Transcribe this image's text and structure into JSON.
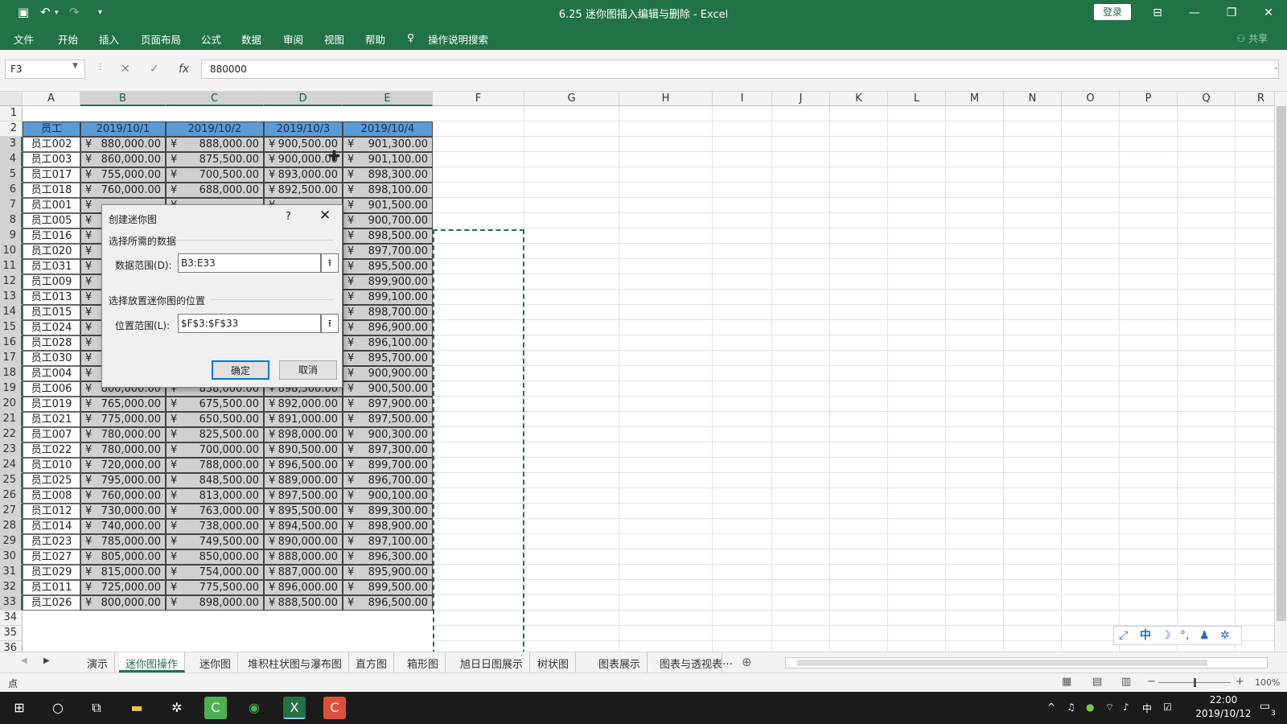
{
  "app": {
    "doc_title": "6.25 迷你图插入编辑与删除  -  Excel",
    "login": "登录",
    "share": "共享",
    "brand_color": "#217346"
  },
  "ribbon_tabs": [
    "文件",
    "开始",
    "插入",
    "页面布局",
    "公式",
    "数据",
    "审阅",
    "视图",
    "帮助",
    "操作说明搜索"
  ],
  "formula": {
    "name_box": "F3",
    "value": "880000"
  },
  "columns": [
    "A",
    "B",
    "C",
    "D",
    "E",
    "F",
    "G",
    "H",
    "I",
    "J",
    "K",
    "L",
    "M",
    "N",
    "O",
    "P",
    "Q",
    "R"
  ],
  "row_numbers": [
    "1",
    "2",
    "3",
    "4",
    "5",
    "6",
    "7",
    "8",
    "9",
    "10",
    "11",
    "12",
    "13",
    "14",
    "15",
    "16",
    "17",
    "18",
    "19",
    "20",
    "21",
    "22",
    "23",
    "24",
    "25",
    "26",
    "27",
    "28",
    "29",
    "30",
    "31",
    "32",
    "33",
    "34",
    "35",
    "36"
  ],
  "table": {
    "headers": [
      "员工",
      "2019/10/1",
      "2019/10/2",
      "2019/10/3",
      "2019/10/4"
    ],
    "currency": "¥",
    "rows": [
      [
        "员工002",
        "880,000.00",
        "888,000.00",
        "900,500.00",
        "901,300.00"
      ],
      [
        "员工003",
        "860,000.00",
        "875,500.00",
        "900,000.00",
        "901,100.00"
      ],
      [
        "员工017",
        "755,000.00",
        "700,500.00",
        "893,000.00",
        "898,300.00"
      ],
      [
        "员工018",
        "760,000.00",
        "688,000.00",
        "892,500.00",
        "898,100.00"
      ],
      [
        "员工001",
        "",
        "",
        "",
        "901,500.00"
      ],
      [
        "员工005",
        "",
        "",
        "",
        "900,700.00"
      ],
      [
        "员工016",
        "",
        "",
        "",
        "898,500.00"
      ],
      [
        "员工020",
        "",
        "",
        "",
        "897,700.00"
      ],
      [
        "员工031",
        "",
        "",
        "",
        "895,500.00"
      ],
      [
        "员工009",
        "",
        "",
        "",
        "899,900.00"
      ],
      [
        "员工013",
        "",
        "",
        "",
        "899,100.00"
      ],
      [
        "员工015",
        "",
        "",
        "",
        "898,700.00"
      ],
      [
        "员工024",
        "",
        "",
        "",
        "896,900.00"
      ],
      [
        "员工028",
        "",
        "",
        "",
        "896,100.00"
      ],
      [
        "员工030",
        "",
        "",
        "",
        "895,700.00"
      ],
      [
        "员工004",
        "",
        "",
        "",
        "900,900.00"
      ],
      [
        "员工006",
        "800,000.00",
        "838,000.00",
        "898,500.00",
        "900,500.00"
      ],
      [
        "员工019",
        "765,000.00",
        "675,500.00",
        "892,000.00",
        "897,900.00"
      ],
      [
        "员工021",
        "775,000.00",
        "650,500.00",
        "891,000.00",
        "897,500.00"
      ],
      [
        "员工007",
        "780,000.00",
        "825,500.00",
        "898,000.00",
        "900,300.00"
      ],
      [
        "员工022",
        "780,000.00",
        "700,000.00",
        "890,500.00",
        "897,300.00"
      ],
      [
        "员工010",
        "720,000.00",
        "788,000.00",
        "896,500.00",
        "899,700.00"
      ],
      [
        "员工025",
        "795,000.00",
        "848,500.00",
        "889,000.00",
        "896,700.00"
      ],
      [
        "员工008",
        "760,000.00",
        "813,000.00",
        "897,500.00",
        "900,100.00"
      ],
      [
        "员工012",
        "730,000.00",
        "763,000.00",
        "895,500.00",
        "899,300.00"
      ],
      [
        "员工014",
        "740,000.00",
        "738,000.00",
        "894,500.00",
        "898,900.00"
      ],
      [
        "员工023",
        "785,000.00",
        "749,500.00",
        "890,000.00",
        "897,100.00"
      ],
      [
        "员工027",
        "805,000.00",
        "850,000.00",
        "888,000.00",
        "896,300.00"
      ],
      [
        "员工029",
        "815,000.00",
        "754,000.00",
        "887,000.00",
        "895,900.00"
      ],
      [
        "员工011",
        "725,000.00",
        "775,500.00",
        "896,000.00",
        "899,500.00"
      ],
      [
        "员工026",
        "800,000.00",
        "898,000.00",
        "888,500.00",
        "896,500.00"
      ]
    ]
  },
  "dialog": {
    "title": "创建迷你图",
    "help": "?",
    "section1": "选择所需的数据",
    "data_range_label": "数据范围(D):",
    "data_range_value": "B3:E33",
    "section2": "选择放置迷你图的位置",
    "location_label": "位置范围(L):",
    "location_value": "$F$3:$F$33",
    "ok": "确定",
    "cancel": "取消"
  },
  "sheet_tabs": [
    "演示",
    "迷你图操作",
    "迷你图",
    "堆积柱状图与瀑布图",
    "直方图",
    "箱形图",
    "旭日日图展示",
    "树状图",
    "图表展示",
    "图表与透视表"
  ],
  "active_sheet": "迷你图操作",
  "status": {
    "mode": "点",
    "zoom": "100%"
  },
  "ime_bar": [
    "中"
  ],
  "taskbar": {
    "time": "22:00",
    "date": "2019/10/12",
    "lang": "中",
    "notifications": "3"
  }
}
